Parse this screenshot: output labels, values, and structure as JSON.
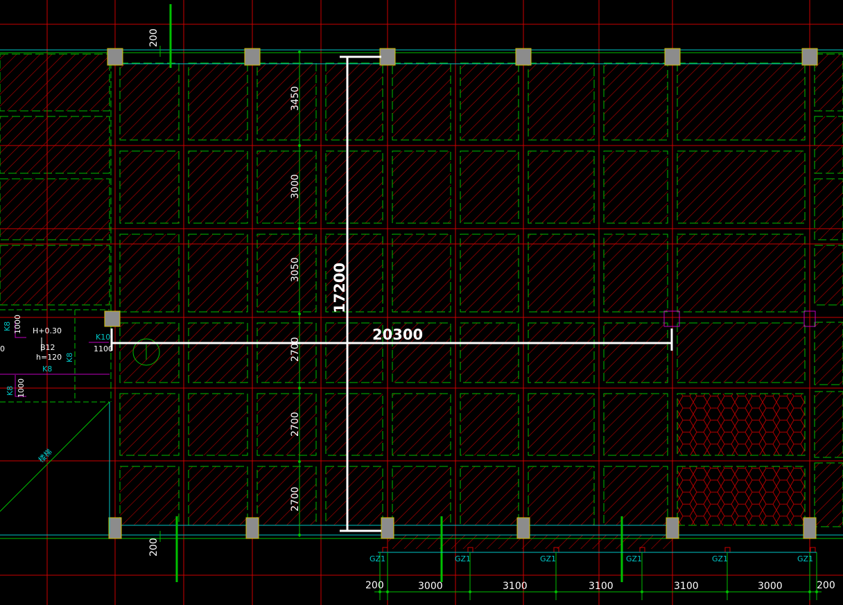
{
  "colors": {
    "background": "#000000",
    "grid_red": "#cc0000",
    "beam_green": "#00c000",
    "dim_white": "#ffffff",
    "cyan": "#00c8c8",
    "magenta": "#c000c0",
    "column_fill": "#8c8c8c",
    "column_edge": "#d4c000",
    "hatch": "#b00000"
  },
  "overall_dims": {
    "horizontal": "20300",
    "vertical": "17200"
  },
  "bottom_dims": [
    "200",
    "3000",
    "3100",
    "3100",
    "3100",
    "3000",
    "200"
  ],
  "left_dims": [
    "3450",
    "3000",
    "3050",
    "2700",
    "2700",
    "2700"
  ],
  "edge_dims": {
    "top": "200",
    "bottom": "200"
  },
  "column_tags": [
    "GZ1",
    "GZ1",
    "GZ1",
    "GZ1",
    "GZ1",
    "GZ1"
  ],
  "left_annotations": {
    "k8_a": "K8",
    "k8_a_len": "1000",
    "h_level": "H+0.30",
    "beam": "B12",
    "h_thickness": "h=120",
    "k8_b": "K8",
    "k8_c": "K8",
    "k8_c_len": "1000",
    "k8_vertical": "K8",
    "k10": "K10",
    "k10_len": "1100",
    "stair": "楼梯",
    "edge_zero": "0"
  }
}
